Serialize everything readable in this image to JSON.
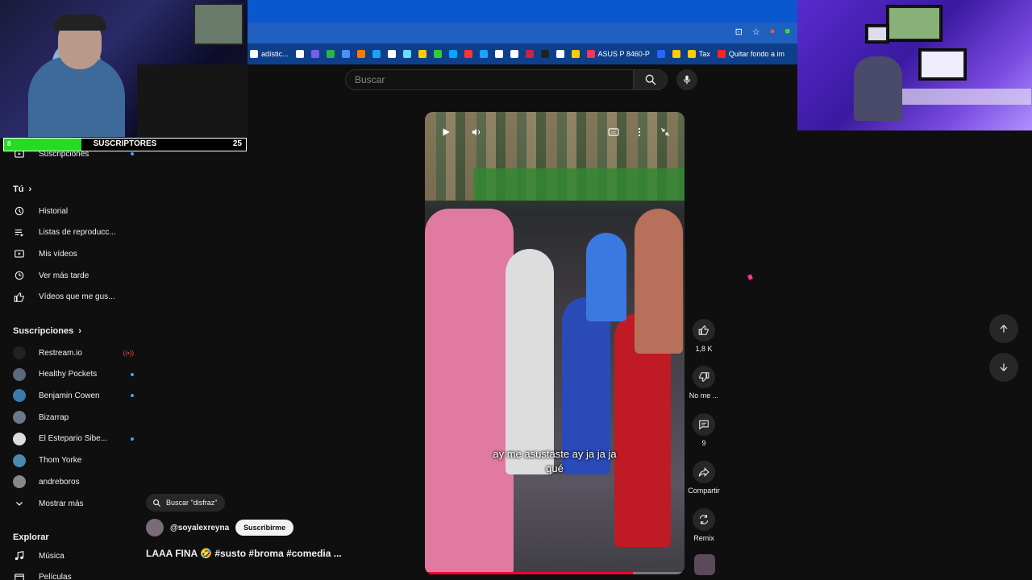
{
  "bookmarks": {
    "items": [
      {
        "label": "adístic...",
        "color": "#ffffff"
      },
      {
        "label": "",
        "color": "#ffffff"
      },
      {
        "label": "",
        "color": "#7a5af0"
      },
      {
        "label": "",
        "color": "#2bb24c"
      },
      {
        "label": "",
        "color": "#4a90ff"
      },
      {
        "label": "",
        "color": "#ff7a00"
      },
      {
        "label": "",
        "color": "#1ea0ff"
      },
      {
        "label": "",
        "color": "#ffffff"
      },
      {
        "label": "",
        "color": "#66ddff"
      },
      {
        "label": "",
        "color": "#ffcc00"
      },
      {
        "label": "",
        "color": "#33cc33"
      },
      {
        "label": "",
        "color": "#00aaff"
      },
      {
        "label": "",
        "color": "#ff3333"
      },
      {
        "label": "",
        "color": "#1ea0ff"
      },
      {
        "label": "",
        "color": "#ffffff"
      },
      {
        "label": "",
        "color": "#ffffff"
      },
      {
        "label": "",
        "color": "#cc2244"
      },
      {
        "label": "",
        "color": "#222222"
      },
      {
        "label": "",
        "color": "#ffffff"
      },
      {
        "label": "",
        "color": "#ffcc00"
      },
      {
        "label": "ASUS P 8460-P",
        "color": "#ff3355"
      },
      {
        "label": "",
        "color": "#2266ff"
      },
      {
        "label": "",
        "color": "#ffcc00"
      },
      {
        "label": "Tax",
        "color": "#ffcc00"
      },
      {
        "label": "Quitar fondo a im",
        "color": "#ff2222"
      }
    ]
  },
  "search": {
    "placeholder": "Buscar"
  },
  "overlay": {
    "subscribers_label": "SUSCRIPTORES",
    "subscribers_count": "25",
    "subscribers_current": "8",
    "subscribers_progress": 0.32
  },
  "sidebar": {
    "subscriptions_top": "Suscripciones",
    "you_header": "Tú",
    "you_items": [
      {
        "label": "Historial",
        "icon": "history-icon"
      },
      {
        "label": "Listas de reproducc...",
        "icon": "playlist-icon"
      },
      {
        "label": "Mis vídeos",
        "icon": "my-videos-icon"
      },
      {
        "label": "Ver más tarde",
        "icon": "watch-later-icon"
      },
      {
        "label": "Vídeos que me gus...",
        "icon": "liked-icon"
      }
    ],
    "subscriptions_header": "Suscripciones",
    "subscriptions": [
      {
        "label": "Restream.io",
        "avatar": "#222222",
        "status": "live"
      },
      {
        "label": "Healthy Pockets",
        "avatar": "#5a6a7a",
        "status": "dot"
      },
      {
        "label": "Benjamin Cowen",
        "avatar": "#3a7ab0",
        "status": "dot"
      },
      {
        "label": "Bizarrap",
        "avatar": "#6a7a8a",
        "status": ""
      },
      {
        "label": "El Estepario Sibe...",
        "avatar": "#dddddd",
        "status": "dot"
      },
      {
        "label": "Thom Yorke",
        "avatar": "#4a8ab0",
        "status": ""
      },
      {
        "label": "andreboros",
        "avatar": "#888888",
        "status": ""
      }
    ],
    "show_more": "Mostrar más",
    "explore_header": "Explorar",
    "explore_items": [
      {
        "label": "Música",
        "icon": "music-icon"
      },
      {
        "label": "Películas",
        "icon": "movies-icon"
      }
    ]
  },
  "video": {
    "caption_line1": "ay me asustaste ay ja ja ja",
    "caption_line2": "qué",
    "progress": 0.8
  },
  "actions": {
    "likes": "1,8 K",
    "dislike": "No me ...",
    "comments": "9",
    "share": "Compartir",
    "remix": "Remix"
  },
  "meta": {
    "search_chip": "Buscar \"disfraz\"",
    "channel": "@soyalexreyna",
    "subscribe": "Suscribirme",
    "title": "LAAA FINA 🤣 #susto #broma #comedia ..."
  }
}
